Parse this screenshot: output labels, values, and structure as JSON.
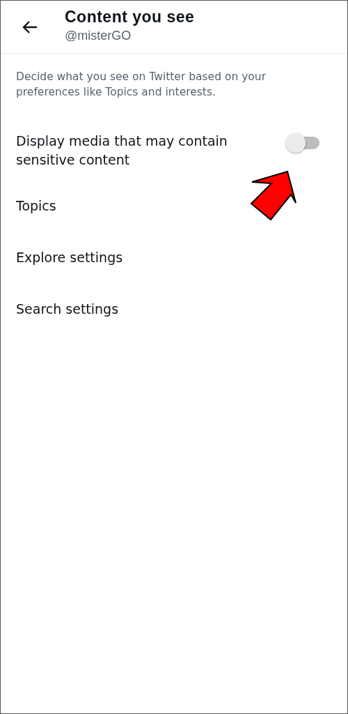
{
  "header": {
    "title": "Content you see",
    "handle": "@misterGO"
  },
  "description": "Decide what you see on Twitter based on your preferences like Topics and interests.",
  "items": [
    {
      "kind": "toggle",
      "label": "Display media that may contain sensitive content",
      "on": false
    },
    {
      "kind": "link",
      "label": "Topics"
    },
    {
      "kind": "link",
      "label": "Explore settings"
    },
    {
      "kind": "link",
      "label": "Search settings"
    }
  ]
}
